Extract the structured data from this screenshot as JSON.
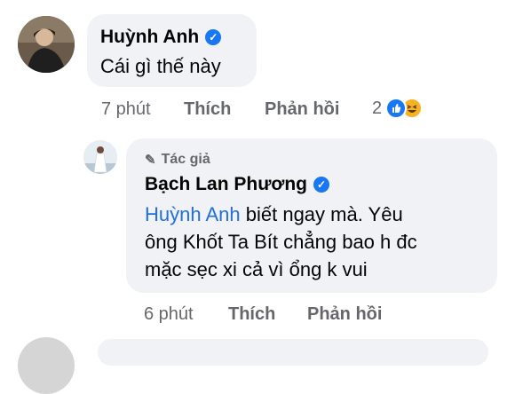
{
  "comment1": {
    "author": "Huỳnh Anh",
    "text": "Cái gì thế này",
    "time": "7 phút",
    "like_label": "Thích",
    "reply_label": "Phản hồi",
    "reaction_count": "2",
    "reaction_icons": [
      "like-icon",
      "haha-icon"
    ]
  },
  "reply1": {
    "author_tag": "Tác giả",
    "author": "Bạch Lan Phương",
    "mention": "Huỳnh Anh",
    "text_line1": " biết ngay mà. Yêu",
    "text_line2": "ông Khốt Ta Bít chẳng bao h đc",
    "text_line3": "mặc sẹc xi cả vì ổng k vui",
    "time": "6 phút",
    "like_label": "Thích",
    "reply_label": "Phản hồi"
  },
  "colors": {
    "bubble": "#f0f2f5",
    "verified": "#1877f2",
    "mention": "#216fdb",
    "meta": "#65676b"
  }
}
